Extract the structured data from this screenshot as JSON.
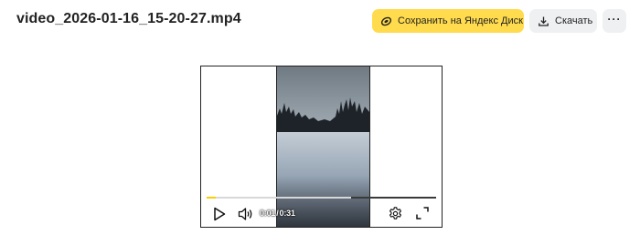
{
  "file": {
    "name": "video_2026-01-16_15-20-27.mp4"
  },
  "toolbar": {
    "save_label": "Сохранить на Яндекс Диск",
    "save_icon": "yandex-disk-icon",
    "download_label": "Скачать",
    "download_icon": "download-icon",
    "more_icon": "more-dots-icon",
    "more_label": "···"
  },
  "player": {
    "current_time": "0:01",
    "separator": "/",
    "duration": "0:31",
    "progress_fraction": 0.04,
    "buffered_fraction": 0.63,
    "icons": {
      "play": "play-icon",
      "volume": "volume-icon",
      "settings": "gear-icon",
      "fullscreen": "fullscreen-icon"
    }
  },
  "colors": {
    "accent": "#ffdb4d",
    "progress": "#ffcc00",
    "button_bg": "#eef0f2"
  }
}
